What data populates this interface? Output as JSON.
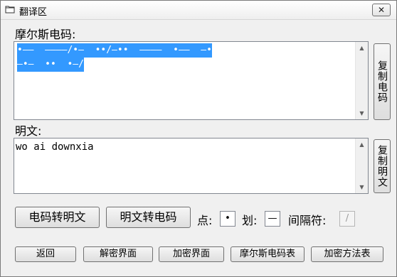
{
  "window": {
    "title": "翻译区",
    "close_glyph": "✕"
  },
  "morse_section": {
    "label": "摩尔斯电码:",
    "lines": [
      "•——  ————/•—  ••/—••  ————  •——  —•",
      "—•—  ••  •—/"
    ],
    "copy_button": "复制电码"
  },
  "plain_section": {
    "label": "明文:",
    "text": "wo ai downxia",
    "copy_button": "复制明文"
  },
  "actions": {
    "code_to_plain": "电码转明文",
    "plain_to_code": "明文转电码"
  },
  "symbols": {
    "dot_label": "点:",
    "dot_value": "•",
    "dash_label": "划:",
    "dash_value": "—",
    "sep_label": "间隔符:",
    "sep_value": "/"
  },
  "bottom_buttons": {
    "back": "返回",
    "decrypt_ui": "解密界面",
    "encrypt_ui": "加密界面",
    "morse_table": "摩尔斯电码表",
    "method_table": "加密方法表"
  },
  "icons": {
    "title": "window-folder-icon",
    "scroll_up": "scroll-up-arrow-icon",
    "scroll_down": "scroll-down-arrow-icon"
  },
  "colors": {
    "selection": "#3399ff"
  }
}
